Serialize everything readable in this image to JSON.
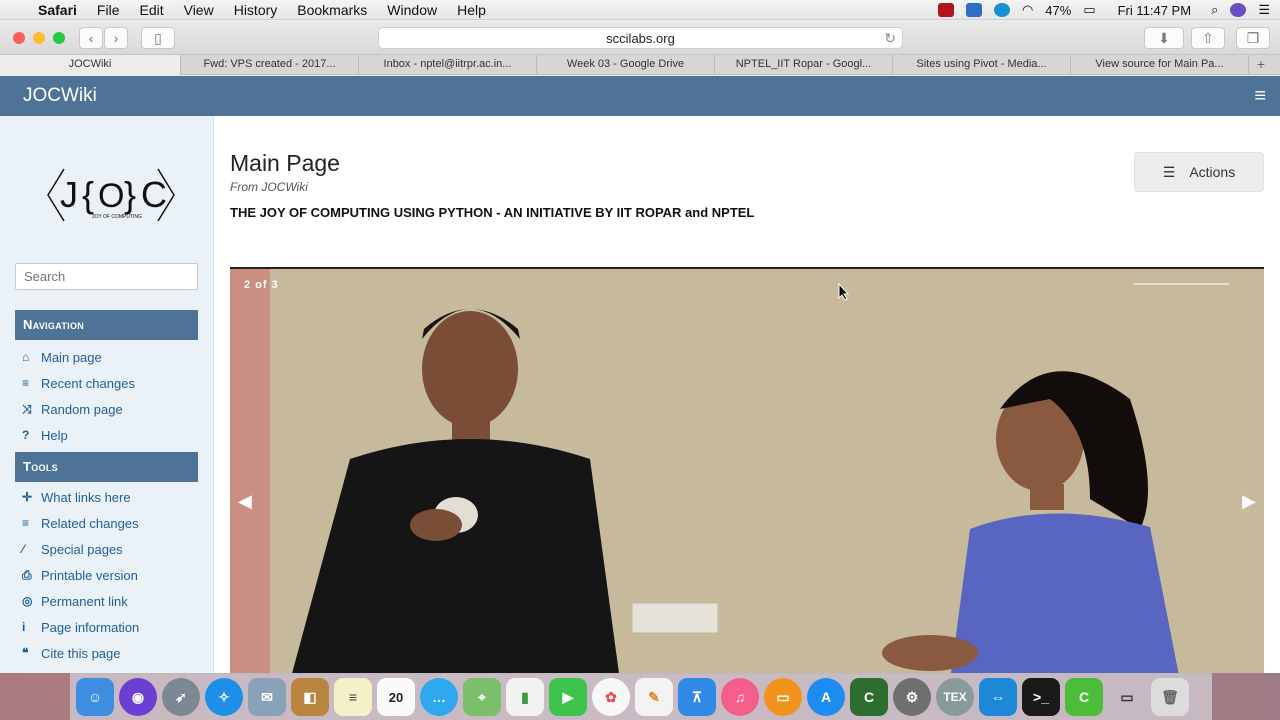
{
  "menubar": {
    "app": "Safari",
    "items": [
      "File",
      "Edit",
      "View",
      "History",
      "Bookmarks",
      "Window",
      "Help"
    ],
    "battery": "47%",
    "clock": "Fri 11:47 PM"
  },
  "toolbar": {
    "url": "sccilabs.org"
  },
  "tabs": [
    "JOCWiki",
    "Fwd: VPS created - 2017...",
    "Inbox - nptel@iitrpr.ac.in...",
    "Week 03 - Google Drive",
    "NPTEL_IIT Ropar - Googl...",
    "Sites using Pivot - Media...",
    "View source for Main Pa..."
  ],
  "wiki": {
    "brand": "JOCWiki",
    "search_placeholder": "Search",
    "navigation_heading": "Navigation",
    "navigation": [
      {
        "icon": "home-icon",
        "glyph": "⌂",
        "label": "Main page"
      },
      {
        "icon": "list-icon",
        "glyph": "≡",
        "label": "Recent changes"
      },
      {
        "icon": "shuffle-icon",
        "glyph": "⤨",
        "label": "Random page"
      },
      {
        "icon": "question-icon",
        "glyph": "?",
        "label": "Help"
      }
    ],
    "tools_heading": "Tools",
    "tools": [
      {
        "icon": "move-icon",
        "glyph": "✛",
        "label": "What links here"
      },
      {
        "icon": "list-icon",
        "glyph": "≡",
        "label": "Related changes"
      },
      {
        "icon": "wand-icon",
        "glyph": "⁄",
        "label": "Special pages"
      },
      {
        "icon": "print-icon",
        "glyph": "⎙",
        "label": "Printable version"
      },
      {
        "icon": "target-icon",
        "glyph": "◎",
        "label": "Permanent link"
      },
      {
        "icon": "info-icon",
        "glyph": "i",
        "label": "Page information"
      },
      {
        "icon": "quote-icon",
        "glyph": "❝",
        "label": "Cite this page"
      }
    ],
    "page_title": "Main Page",
    "from": "From JOCWiki",
    "tagline": "THE JOY OF COMPUTING USING PYTHON - AN INITIATIVE BY IIT ROPAR and NPTEL",
    "actions_label": "Actions",
    "slide_counter": "2 of 3"
  },
  "colors": {
    "header": "#4f7396",
    "link": "#1f5f99"
  }
}
